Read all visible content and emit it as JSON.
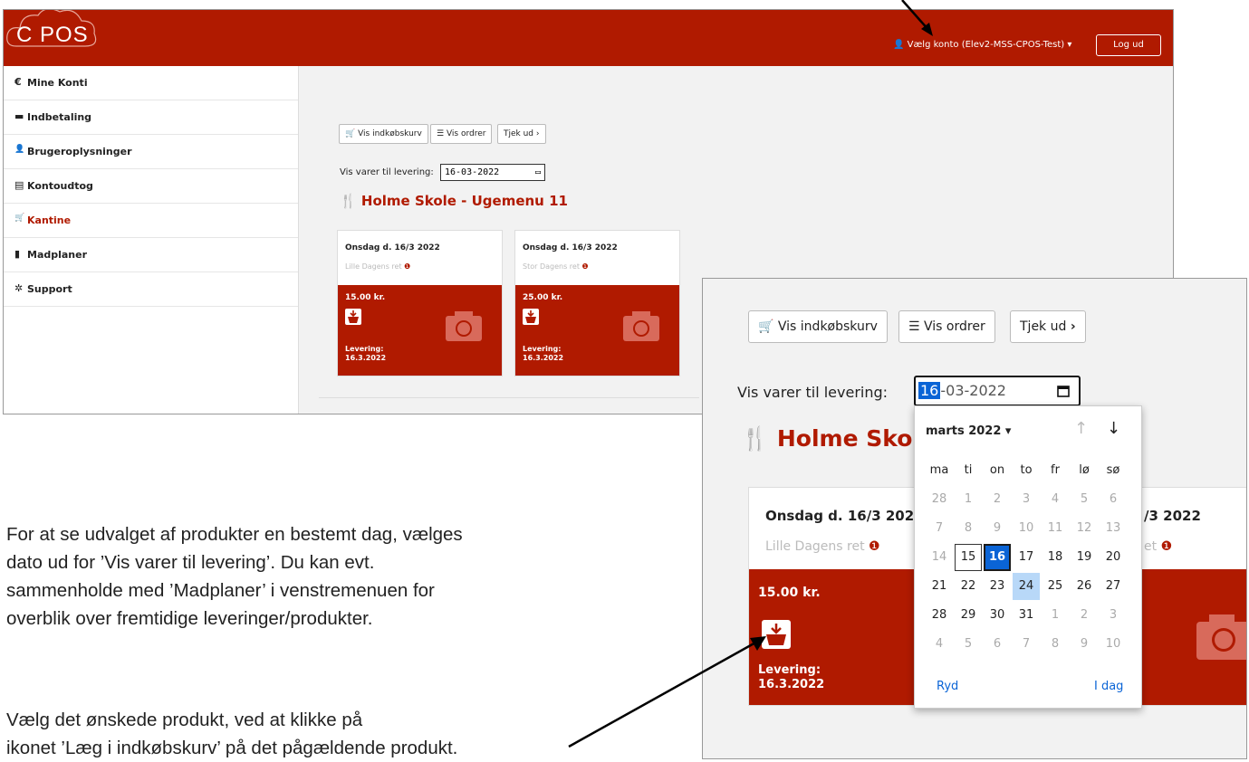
{
  "app": {
    "logo": "C POS",
    "account_label": "Vælg konto (Elev2-MSS-CPOS-Test)",
    "logout": "Log ud"
  },
  "sidebar": {
    "items": [
      {
        "label": "Mine Konti",
        "icon": "euro-icon",
        "glyph": "€"
      },
      {
        "label": "Indbetaling",
        "icon": "card-icon",
        "glyph": "▬"
      },
      {
        "label": "Brugeroplysninger",
        "icon": "user-icon",
        "glyph": "👤"
      },
      {
        "label": "Kontoudtog",
        "icon": "statement-icon",
        "glyph": "▤"
      },
      {
        "label": "Kantine",
        "icon": "cart-icon",
        "glyph": "🛒"
      },
      {
        "label": "Madplaner",
        "icon": "file-icon",
        "glyph": "▮"
      },
      {
        "label": "Support",
        "icon": "gear-icon",
        "glyph": "✲"
      }
    ],
    "active": "Kantine"
  },
  "toolbar": {
    "basket": "Vis indkøbskurv",
    "orders": "Vis ordrer",
    "checkout": "Tjek ud"
  },
  "filter": {
    "label": "Vis varer til levering:",
    "date_value": "16-03-2022",
    "date_day": "16",
    "date_rest": "-03-2022"
  },
  "menu_title": "Holme Skole - Ugemenu 11",
  "products": [
    {
      "day": "Onsdag d. 16/3 2022",
      "name": "Lille Dagens ret",
      "price": "15.00 kr.",
      "delivery_label": "Levering:",
      "delivery_date": "16.3.2022"
    },
    {
      "day": "Onsdag d. 16/3 2022",
      "name": "Stor Dagens ret",
      "price": "25.00 kr.",
      "delivery_label": "Levering:",
      "delivery_date": "16.3.2022"
    }
  ],
  "zoom_card": {
    "day_partial": "Onsdag d. 16/3 2022",
    "day_right_partial": "/3 2022",
    "name": "Lille Dagens ret",
    "name_right_partial": "et",
    "price": "15.00 kr.",
    "delivery_label": "Levering:",
    "delivery_date": "16.3.2022",
    "menu_partial": "Holme Sko"
  },
  "calendar": {
    "month": "marts 2022",
    "weekdays": [
      "ma",
      "ti",
      "on",
      "to",
      "fr",
      "lø",
      "sø"
    ],
    "weeks": [
      [
        "28",
        "1",
        "2",
        "3",
        "4",
        "5",
        "6"
      ],
      [
        "7",
        "8",
        "9",
        "10",
        "11",
        "12",
        "13"
      ],
      [
        "14",
        "15",
        "16",
        "17",
        "18",
        "19",
        "20"
      ],
      [
        "21",
        "22",
        "23",
        "24",
        "25",
        "26",
        "27"
      ],
      [
        "28",
        "29",
        "30",
        "31",
        "1",
        "2",
        "3"
      ],
      [
        "4",
        "5",
        "6",
        "7",
        "8",
        "9",
        "10"
      ]
    ],
    "clear": "Ryd",
    "today": "I dag",
    "selected": "16",
    "today_marker": "15",
    "hover": "24"
  },
  "instructions": {
    "para1": [
      "For at se udvalget af produkter en bestemt dag, vælges",
      "dato ud for ’Vis varer til levering’. Du kan evt.",
      "sammenholde med ’Madplaner’ i venstremenuen for",
      "overblik over fremtidige leveringer/produkter."
    ],
    "para2_line1": "Vælg det ønskede produkt, ved at klikke på",
    "para2_line2": "ikonet ’Læg i indkøbskurv’ på det pågældende produkt."
  },
  "colors": {
    "brand": "#b01a00",
    "selected_day": "#0a64d6",
    "hover_day": "#b8d8f8"
  }
}
